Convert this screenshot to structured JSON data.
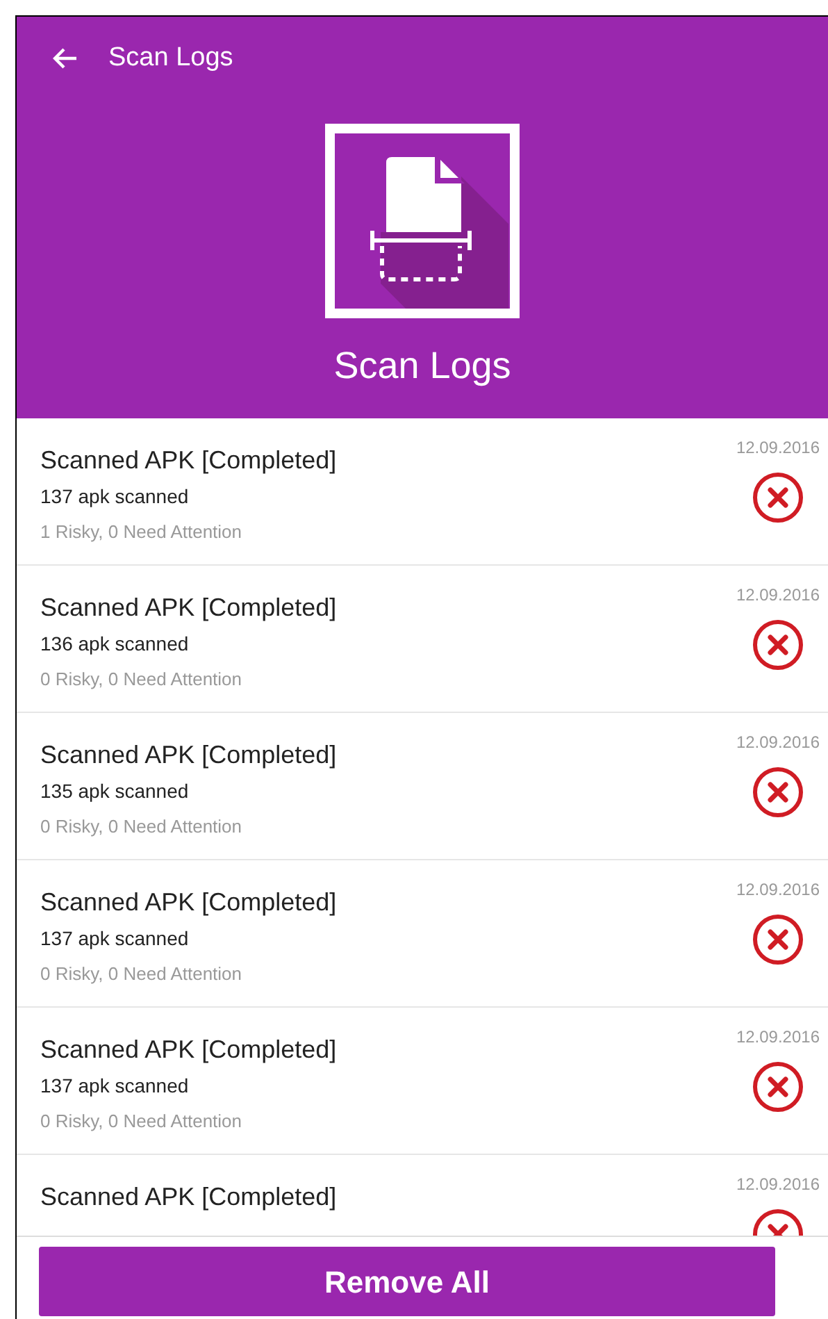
{
  "app_bar": {
    "title": "Scan Logs"
  },
  "hero": {
    "title": "Scan Logs"
  },
  "logs": [
    {
      "title": "Scanned APK [Completed]",
      "count": "137 apk scanned",
      "summary": "1 Risky, 0 Need Attention",
      "date": "12.09.2016"
    },
    {
      "title": "Scanned APK [Completed]",
      "count": "136 apk scanned",
      "summary": "0 Risky, 0 Need Attention",
      "date": "12.09.2016"
    },
    {
      "title": "Scanned APK [Completed]",
      "count": "135 apk scanned",
      "summary": "0 Risky, 0 Need Attention",
      "date": "12.09.2016"
    },
    {
      "title": "Scanned APK [Completed]",
      "count": "137 apk scanned",
      "summary": "0 Risky, 0 Need Attention",
      "date": "12.09.2016"
    },
    {
      "title": "Scanned APK [Completed]",
      "count": "137 apk scanned",
      "summary": "0 Risky, 0 Need Attention",
      "date": "12.09.2016"
    },
    {
      "title": "Scanned APK [Completed]",
      "date": "12.09.2016"
    }
  ],
  "footer": {
    "button": "Remove All"
  }
}
